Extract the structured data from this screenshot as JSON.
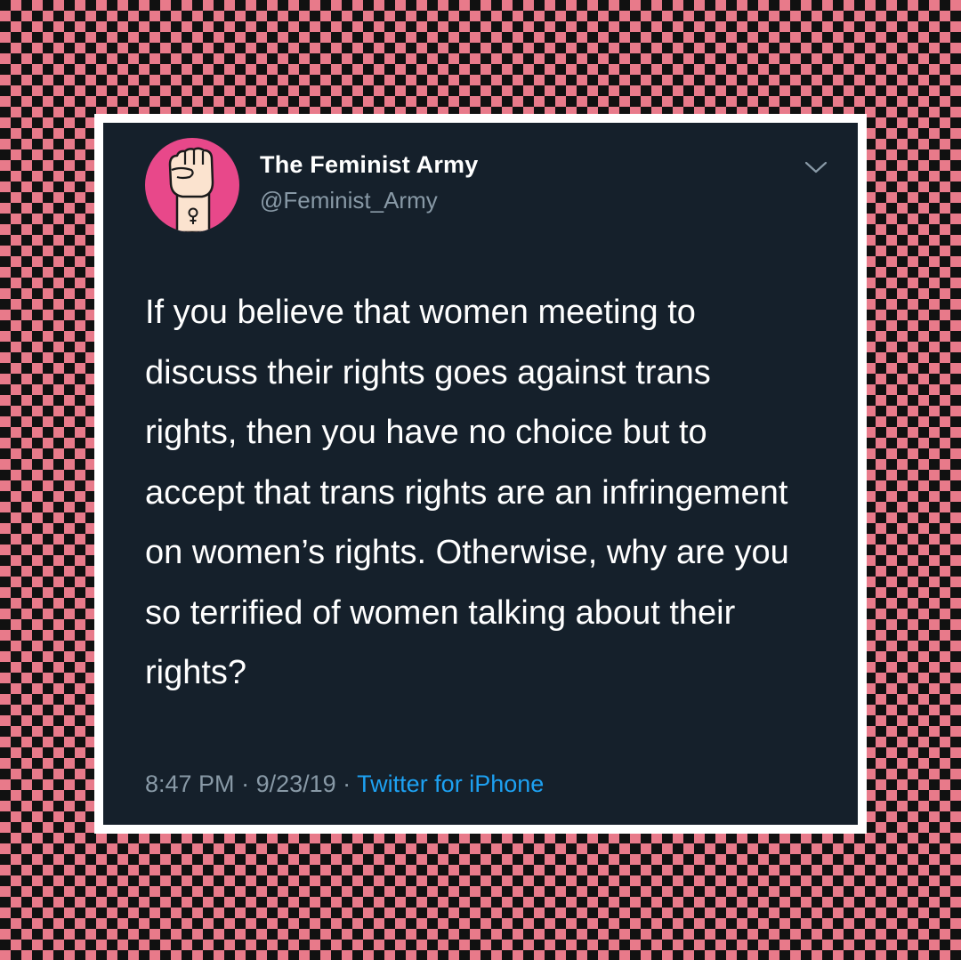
{
  "tweet": {
    "display_name": "The Feminist Army",
    "handle": "@Feminist_Army",
    "text": "If you believe that women meeting to discuss their rights goes against trans rights, then you have no choice but to accept that trans rights are an infringement on women’s rights. Otherwise, why are you so terrified of women talking about their rights?",
    "time": "8:47 PM",
    "separator": " · ",
    "date": "9/23/19",
    "source": "Twitter for iPhone",
    "avatar_icon": "raised-fist-venus-icon",
    "menu_icon": "chevron-down-icon"
  },
  "colors": {
    "checker_pink": "#e87a8a",
    "checker_black": "#111111",
    "tweet_bg": "#15202b",
    "avatar_bg": "#e8488a",
    "link_blue": "#1da1f2",
    "muted_gray": "#8899a6"
  }
}
